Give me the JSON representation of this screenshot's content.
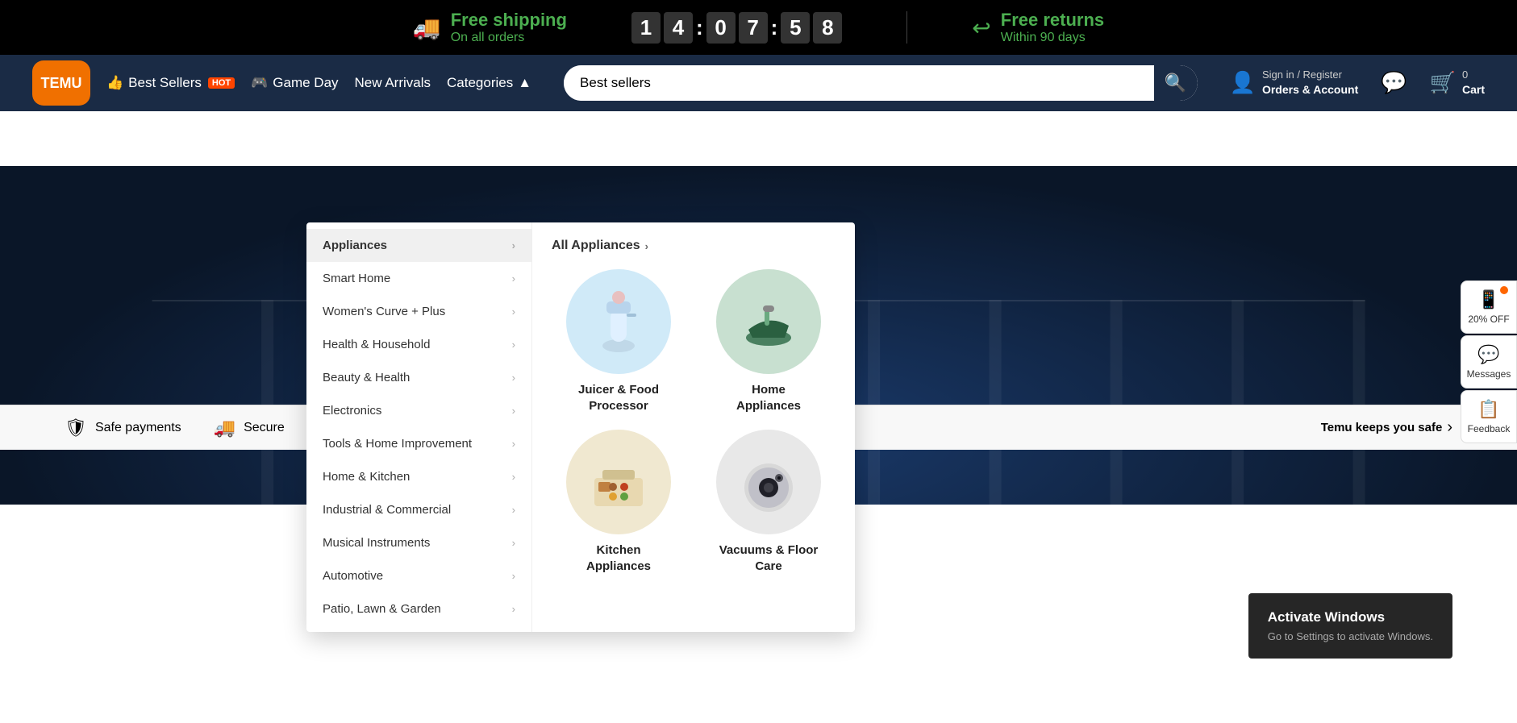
{
  "topbar": {
    "shipping_label": "Free shipping",
    "shipping_sub": "On all orders",
    "timer": {
      "h1": "1",
      "h2": "4",
      "m1": "0",
      "m2": "7",
      "s1": "5",
      "s2": "8"
    },
    "returns_label": "Free returns",
    "returns_sub": "Within 90 days",
    "shipping_icon": "🚚",
    "returns_icon": "↩"
  },
  "navbar": {
    "logo_text": "TEMU",
    "links": [
      {
        "label": "Best Sellers",
        "badge": "HOT",
        "icon": "👍"
      },
      {
        "label": "Game Day",
        "icon": "🎮"
      },
      {
        "label": "New Arrivals"
      },
      {
        "label": "Categories",
        "has_arrow": true
      }
    ],
    "search_placeholder": "Best sellers",
    "search_icon": "🔍",
    "sign_in_top": "Sign in / Register",
    "sign_in_bottom": "Orders & Account",
    "user_icon": "👤",
    "message_icon": "💬",
    "cart_label": "Cart",
    "cart_count": "0",
    "cart_icon": "🛒"
  },
  "dropdown": {
    "all_appliances_label": "All Appliances",
    "menu_items": [
      {
        "label": "Appliances",
        "active": true
      },
      {
        "label": "Smart Home"
      },
      {
        "label": "Women's Curve + Plus"
      },
      {
        "label": "Health & Household"
      },
      {
        "label": "Beauty & Health"
      },
      {
        "label": "Electronics"
      },
      {
        "label": "Tools & Home Improvement"
      },
      {
        "label": "Home & Kitchen"
      },
      {
        "label": "Industrial & Commercial"
      },
      {
        "label": "Musical Instruments"
      },
      {
        "label": "Automotive"
      },
      {
        "label": "Patio, Lawn & Garden"
      }
    ],
    "categories": [
      {
        "label": "Juicer & Food\nProcessor",
        "icon": "🥤",
        "bg": "#e0f0f8"
      },
      {
        "label": "Home\nAppliances",
        "icon": "🏠",
        "bg": "#d8ede8"
      },
      {
        "label": "Kitchen\nAppliances",
        "icon": "🍳",
        "bg": "#f5f0e0"
      },
      {
        "label": "Vacuums & Floor\nCare",
        "icon": "🤖",
        "bg": "#e8e8f0"
      }
    ]
  },
  "trust_bar": {
    "items": [
      {
        "icon": "🛡",
        "label": "Safe payments"
      },
      {
        "icon": "🚚",
        "label": "Secure"
      }
    ],
    "right_label": "Temu keeps you safe",
    "right_arrow": "›"
  },
  "sidebar": {
    "buttons": [
      {
        "icon": "📱",
        "label": "20% OFF"
      },
      {
        "icon": "💬",
        "label": "Messages"
      },
      {
        "icon": "📋",
        "label": "Feedback"
      }
    ]
  },
  "activate": {
    "title": "Activate Windows",
    "sub": "Go to Settings to activate Windows."
  }
}
